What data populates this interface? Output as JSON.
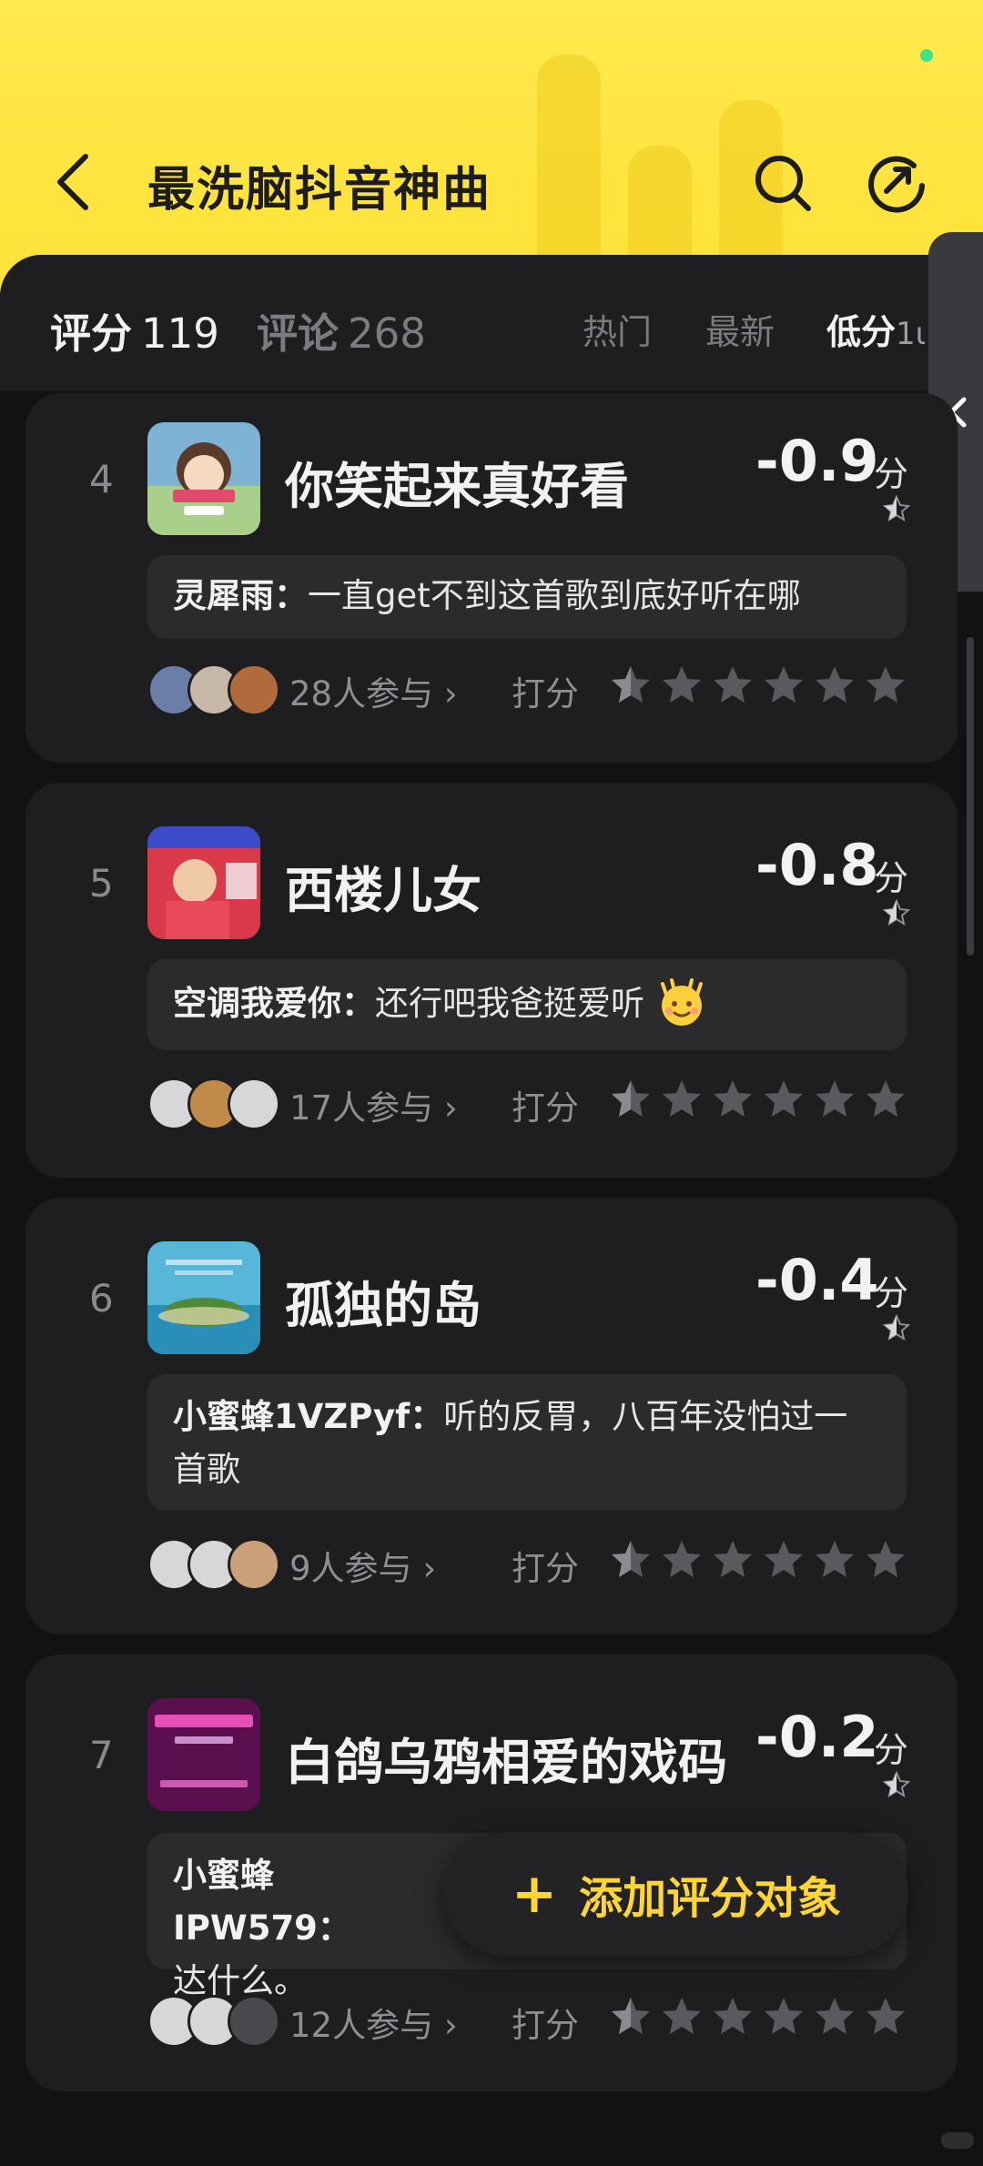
{
  "header": {
    "title": "最洗脑抖音神曲",
    "colors": {
      "background": "#ffe43f",
      "title": "#1d1d1d"
    }
  },
  "tabs": {
    "score_label": "评分",
    "score_count": "119",
    "comment_label": "评论",
    "comment_count": "268",
    "sort_hot": "热门",
    "sort_new": "最新",
    "sort_low": "低分",
    "sort_low_suffix": "1ι"
  },
  "items": [
    {
      "rank": "4",
      "title": "你笑起来真好看",
      "score": "-0.9",
      "unit": "分",
      "comment_user": "灵犀雨：",
      "comment_text": "一直get不到这首歌到底好听在哪",
      "participants": "28人参与",
      "rate_label": "打分",
      "cover_icon": "anime-girl-cover"
    },
    {
      "rank": "5",
      "title": "西楼儿女",
      "score": "-0.8",
      "unit": "分",
      "comment_user": "空调我爱你：",
      "comment_text": "还行吧我爸挺爱听",
      "participants": "17人参与",
      "rate_label": "打分",
      "cover_icon": "singer-karaoke-cover"
    },
    {
      "rank": "6",
      "title": "孤独的岛",
      "score": "-0.4",
      "unit": "分",
      "comment_user": "小蜜蜂1VZPyf：",
      "comment_text": "听的反胃，八百年没怕过一首歌",
      "participants": "9人参与",
      "rate_label": "打分",
      "cover_icon": "island-cover"
    },
    {
      "rank": "7",
      "title": "白鸽乌鸦相爱的戏码",
      "score": "-0.2",
      "unit": "分",
      "comment_user": "小蜜蜂IPW579：",
      "comment_text": "达什么。",
      "participants": "12人参与",
      "rate_label": "打分",
      "cover_icon": "purple-text-cover"
    }
  ],
  "add_button": {
    "label": "添加评分对象",
    "color": "#ffd633"
  }
}
